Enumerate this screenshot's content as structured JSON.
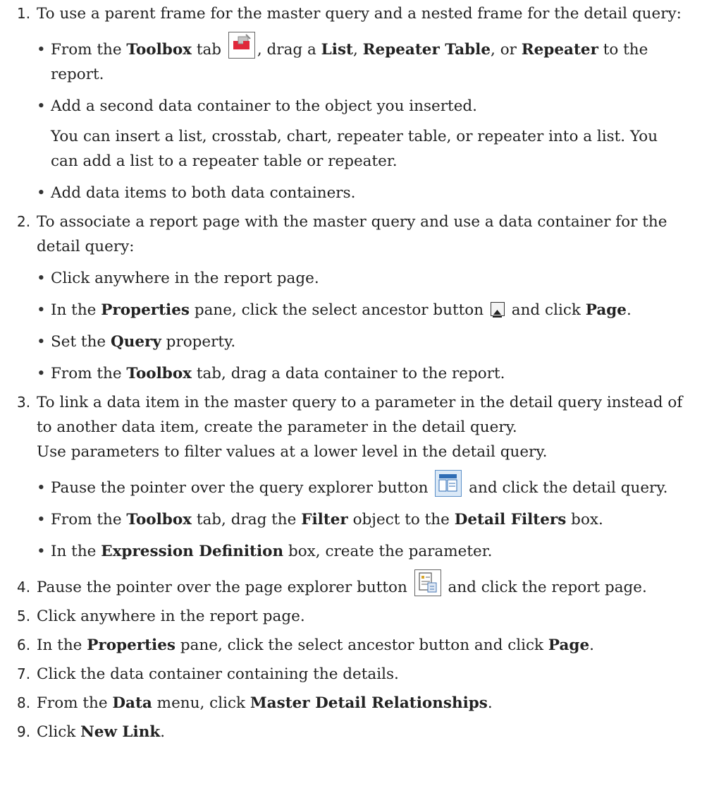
{
  "steps": [
    {
      "num": "1.",
      "text": "To use a parent frame for the master query and a nested frame for the detail query:",
      "bullets": [
        {
          "pre": "From the ",
          "b1": "Toolbox",
          "mid1": " tab ",
          "post_icon": ", drag a ",
          "b2": "List",
          "mid2": ", ",
          "b3": "Repeater Table",
          "mid3": ", or ",
          "b4": "Repeater",
          "tail": " to the report."
        },
        {
          "text": "Add a second data container to the object you inserted.",
          "note": "You can insert a list, crosstab, chart, repeater table, or repeater into a list. You can add a list to a repeater table or repeater."
        },
        {
          "text": "Add data items to both data containers."
        }
      ]
    },
    {
      "num": "2.",
      "text": "To associate a report page with the master query and use a data container for the detail query:",
      "bullets": [
        {
          "text": "Click anywhere in the report page."
        },
        {
          "pre": "In the ",
          "b1": "Properties",
          "mid1": " pane, click the select ancestor button ",
          "post_icon": " and click ",
          "b2": "Page",
          "tail": "."
        },
        {
          "pre": "Set the ",
          "b1": "Query",
          "tail": " property."
        },
        {
          "pre": "From the ",
          "b1": "Toolbox",
          "tail": " tab, drag a data container to the report."
        }
      ]
    },
    {
      "num": "3.",
      "text": "To link a data item in the master query to a parameter in the detail query instead of to another data item, create the parameter in the detail query.",
      "note": "Use parameters to filter values at a lower level in the detail query.",
      "bullets": [
        {
          "pre": "Pause the pointer over the query explorer button ",
          "post_icon": " and click the detail query."
        },
        {
          "pre": "From the ",
          "b1": "Toolbox",
          "mid1": " tab, drag the ",
          "b2": "Filter",
          "mid2": " object to the ",
          "b3": "Detail Filters",
          "tail": " box."
        },
        {
          "pre": "In the ",
          "b1": "Expression Definition",
          "tail": " box, create the parameter."
        }
      ]
    },
    {
      "num": "4.",
      "pre": "Pause the pointer over the page explorer button ",
      "post_icon": " and click the report page."
    },
    {
      "num": "5.",
      "text": "Click anywhere in the report page."
    },
    {
      "num": "6.",
      "pre": "In the ",
      "b1": "Properties",
      "mid1": " pane, click the select ancestor button and click ",
      "b2": "Page",
      "tail": "."
    },
    {
      "num": "7.",
      "text": "Click the data container containing the details."
    },
    {
      "num": "8.",
      "pre": "From the ",
      "b1": "Data",
      "mid1": " menu, click ",
      "b2": "Master Detail Relationships",
      "tail": "."
    },
    {
      "num": "9.",
      "pre": "Click ",
      "b1": "New Link",
      "tail": "."
    }
  ],
  "icons": {
    "toolbox": "toolbox-icon",
    "select_ancestor": "select-ancestor-icon",
    "query_explorer": "query-explorer-icon",
    "page_explorer": "page-explorer-icon"
  }
}
